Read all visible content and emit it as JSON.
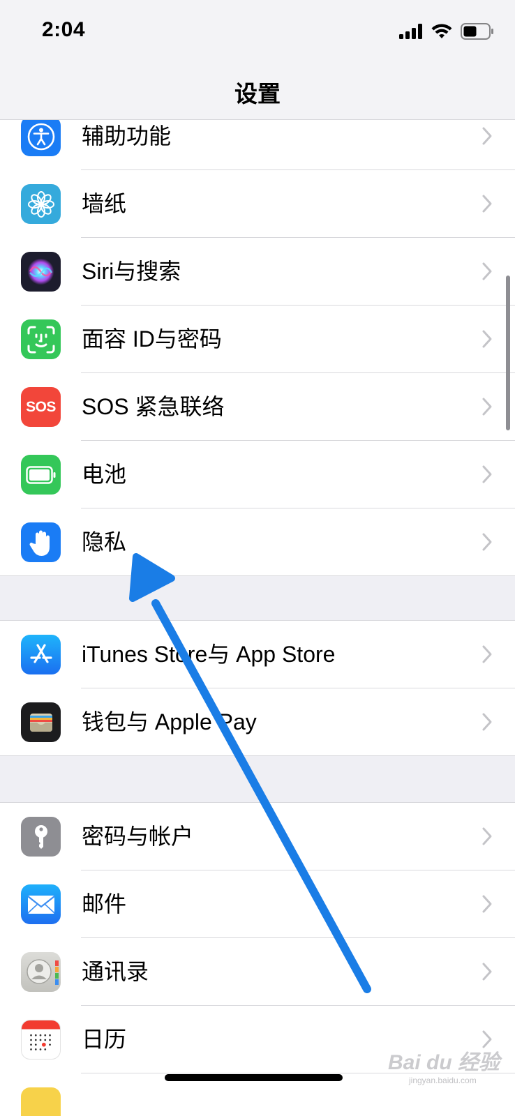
{
  "status_bar": {
    "time": "2:04"
  },
  "nav": {
    "title": "设置"
  },
  "settings_rows": [
    {
      "id": "accessibility",
      "label": "辅助功能",
      "icon": "accessibility-icon",
      "color": "#1a7cf5"
    },
    {
      "id": "wallpaper",
      "label": "墙纸",
      "icon": "wallpaper-flower-icon",
      "color": "#35aadc"
    },
    {
      "id": "siri",
      "label": "Siri与搜索",
      "icon": "siri-icon",
      "color": "#1d1d2e"
    },
    {
      "id": "faceid",
      "label": "面容 ID与密码",
      "icon": "faceid-icon",
      "color": "#34c759"
    },
    {
      "id": "sos",
      "label": "SOS 紧急联络",
      "icon": "sos-icon",
      "icon_text": "SOS",
      "color": "#f2463a"
    },
    {
      "id": "battery",
      "label": "电池",
      "icon": "battery-icon",
      "color": "#34c759"
    },
    {
      "id": "privacy",
      "label": "隐私",
      "icon": "privacy-hand-icon",
      "color": "#1a7cf5"
    },
    {
      "id": "appstore",
      "label": "iTunes Store与 App Store",
      "icon": "app-store-icon",
      "color": "#1e8ef5"
    },
    {
      "id": "wallet",
      "label": "钱包与 Apple Pay",
      "icon": "wallet-icon",
      "color": "#1c1c1e"
    },
    {
      "id": "passwords",
      "label": "密码与帐户",
      "icon": "key-icon",
      "color": "#8e8e93"
    },
    {
      "id": "mail",
      "label": "邮件",
      "icon": "mail-icon",
      "color": "#2e8cf0"
    },
    {
      "id": "contacts",
      "label": "通讯录",
      "icon": "contacts-icon",
      "color": "#c9c9c4"
    },
    {
      "id": "calendar",
      "label": "日历",
      "icon": "calendar-icon",
      "color": "#ffffff"
    }
  ],
  "annotation": {
    "arrow_color": "#1a7de6"
  },
  "watermark": {
    "text": "Bai du 经验",
    "subtext": "jingyan.baidu.com"
  }
}
